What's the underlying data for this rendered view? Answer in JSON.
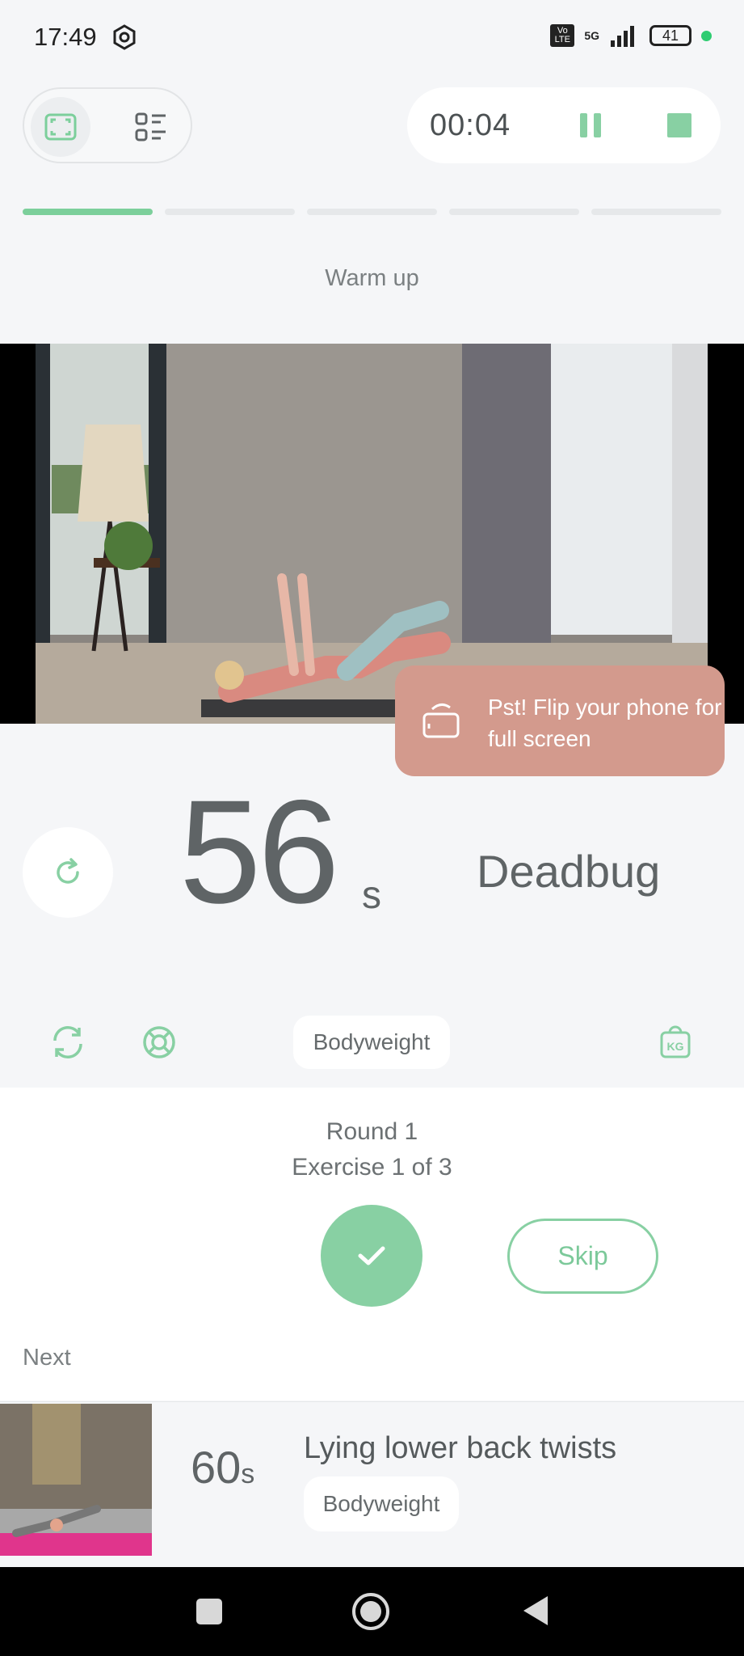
{
  "status_bar": {
    "time": "17:49",
    "network": "5G",
    "volte": "Vo LTE",
    "battery": "41"
  },
  "top_bar": {
    "timer": "00:04"
  },
  "workout": {
    "section_title": "Warm up",
    "progress": {
      "segments": 5,
      "current_segment": 1
    }
  },
  "video": {
    "flip_hint": "Pst! Flip your phone for full screen"
  },
  "exercise": {
    "seconds": "56",
    "unit": "s",
    "name": "Deadbug",
    "equipment": "Bodyweight"
  },
  "round": {
    "round_label": "Round 1",
    "exercise_label": "Exercise 1 of 3"
  },
  "actions": {
    "skip_label": "Skip"
  },
  "next": {
    "label": "Next",
    "duration": "60",
    "unit": "s",
    "name": "Lying lower back twists",
    "equipment": "Bodyweight"
  },
  "colors": {
    "accent": "#88d0a3",
    "hint_bg": "#d39a8d",
    "background": "#f5f6f8"
  },
  "icons": [
    "settings-icon",
    "fullscreen-icon",
    "list-icon",
    "pause-icon",
    "stop-icon",
    "rotate-phone-icon",
    "restart-icon",
    "swap-icon",
    "help-icon",
    "weight-kg-icon",
    "check-icon",
    "square-nav-icon",
    "home-nav-icon",
    "back-nav-icon"
  ]
}
